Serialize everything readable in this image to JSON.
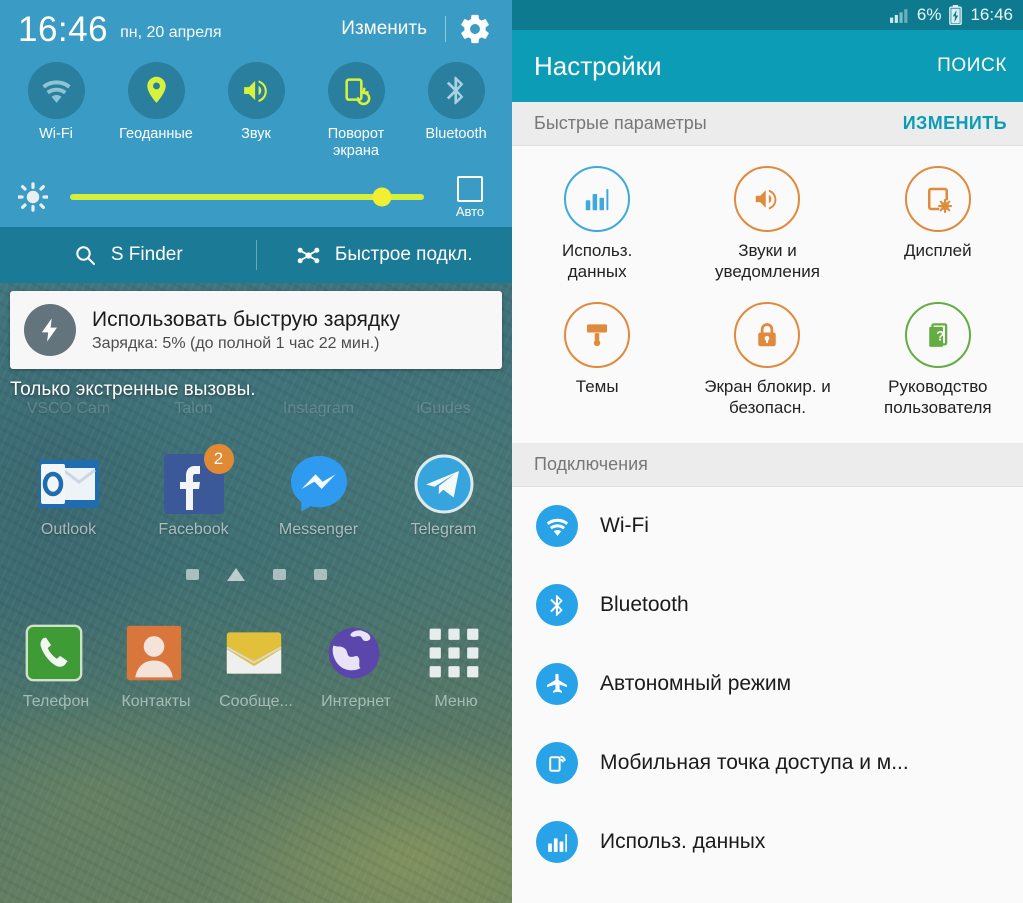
{
  "left_screen": {
    "quick_panel": {
      "clock": "16:46",
      "date": "пн, 20 апреля",
      "edit_label": "Изменить",
      "settings_icon": "gear-icon",
      "toggles": [
        {
          "label": "Wi-Fi",
          "icon": "wifi-icon",
          "active": false
        },
        {
          "label": "Геоданные",
          "icon": "location-pin-icon",
          "active": true
        },
        {
          "label": "Звук",
          "icon": "sound-volume-icon",
          "active": true
        },
        {
          "label": "Поворот\nэкрана",
          "label_line1": "Поворот",
          "label_line2": "экрана",
          "icon": "screen-rotation-icon",
          "active": true
        },
        {
          "label": "Bluetooth",
          "icon": "bluetooth-icon",
          "active": false
        }
      ],
      "brightness": {
        "icon": "brightness-sun-icon",
        "value_percent": 88,
        "auto_label": "Авто",
        "auto_checked": false
      },
      "s_finder_label": "S Finder",
      "quick_connect_label": "Быстрое подкл."
    },
    "notification": {
      "icon": "fast-charging-bolt-icon",
      "title": "Использовать быструю зарядку",
      "subtitle": "Зарядка: 5% (до полной 1 час 22 мин.)"
    },
    "emergency_text": "Только экстренные вызовы.",
    "home_apps_row1": [
      {
        "label": "VSCO Cam"
      },
      {
        "label": "Talon"
      },
      {
        "label": "Instagram"
      },
      {
        "label": "iGuides"
      }
    ],
    "home_apps_row2": [
      {
        "label": "Outlook",
        "icon": "outlook-icon",
        "badge": ""
      },
      {
        "label": "Facebook",
        "icon": "facebook-icon",
        "badge": "2"
      },
      {
        "label": "Messenger",
        "icon": "messenger-icon",
        "badge": ""
      },
      {
        "label": "Telegram",
        "icon": "telegram-icon",
        "badge": ""
      }
    ],
    "dock": [
      {
        "label": "Телефон",
        "icon": "phone-icon"
      },
      {
        "label": "Контакты",
        "icon": "contacts-icon"
      },
      {
        "label": "Сообще...",
        "icon": "messages-icon"
      },
      {
        "label": "Интернет",
        "icon": "internet-globe-icon"
      },
      {
        "label": "Меню",
        "icon": "apps-menu-icon"
      }
    ]
  },
  "right_screen": {
    "status_bar": {
      "signal_icon": "signal-bars-icon",
      "battery_percent": "6%",
      "battery_icon": "battery-charging-icon",
      "time": "16:46"
    },
    "action_bar": {
      "title": "Настройки",
      "search_label": "ПОИСК"
    },
    "quick_section": {
      "title": "Быстрые параметры",
      "action": "ИЗМЕНИТЬ",
      "items": [
        {
          "line1": "Использ.",
          "line2": "данных",
          "icon": "data-usage-bars-icon",
          "color": "blue"
        },
        {
          "line1": "Звуки и",
          "line2": "уведомления",
          "icon": "sound-volume-icon",
          "color": "orange"
        },
        {
          "line1": "Дисплей",
          "line2": "",
          "icon": "display-settings-icon",
          "color": "orange"
        },
        {
          "line1": "Темы",
          "line2": "",
          "icon": "themes-brush-icon",
          "color": "orange"
        },
        {
          "line1": "Экран блокир. и",
          "line2": "безопасн.",
          "icon": "lock-icon",
          "color": "orange"
        },
        {
          "line1": "Руководство",
          "line2": "пользователя",
          "icon": "user-manual-help-icon",
          "color": "green"
        }
      ]
    },
    "connections_section": {
      "title": "Подключения",
      "items": [
        {
          "label": "Wi-Fi",
          "icon": "wifi-icon"
        },
        {
          "label": "Bluetooth",
          "icon": "bluetooth-icon"
        },
        {
          "label": "Автономный режим",
          "icon": "airplane-mode-icon"
        },
        {
          "label": "Мобильная точка доступа и м...",
          "icon": "mobile-hotspot-icon"
        },
        {
          "label": "Использ. данных",
          "icon": "data-usage-bars-icon"
        }
      ]
    }
  },
  "colors": {
    "quick_panel_bg": "#3a9cc4",
    "sfinder_bg": "#1b7a96",
    "toggle_inactive": "#2a7e9e",
    "toggle_active_glyph": "#d6f23c",
    "slider_track": "#d4f03c",
    "slider_thumb": "#f2ee32",
    "status_bar": "#0e7a8f",
    "action_bar": "#0d9cb5",
    "accent_teal": "#0d9cb5",
    "accent_blue": "#29a3e8",
    "accent_orange": "#e08a3c",
    "accent_green": "#63ad42",
    "badge_orange": "#e08a33"
  }
}
